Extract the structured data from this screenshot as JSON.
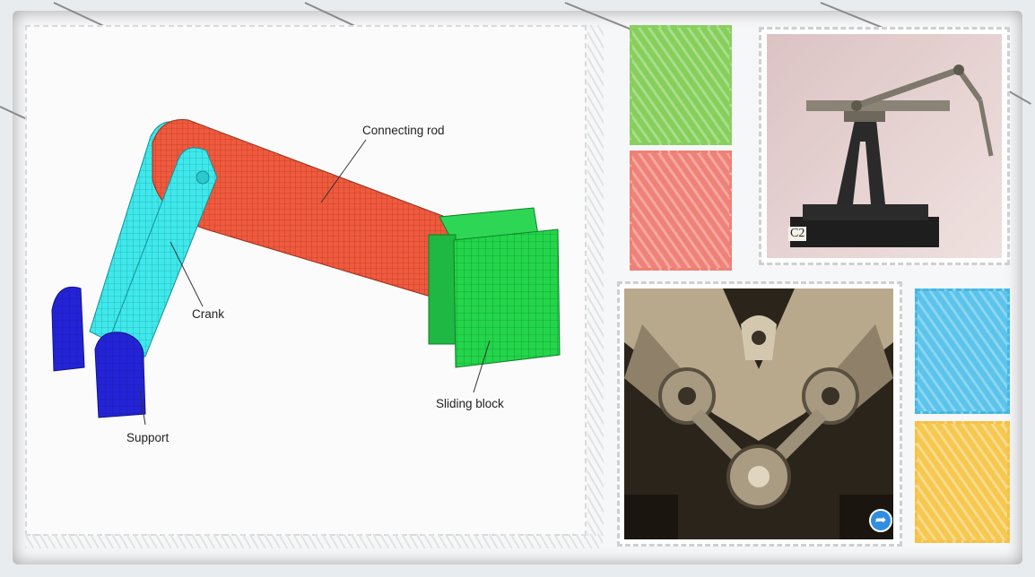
{
  "figure": {
    "labels": {
      "connecting_rod": "Connecting rod",
      "crank": "Crank",
      "sliding_block": "Sliding block",
      "support": "Support"
    },
    "mesh_colors": {
      "connecting_rod": "#ef5a3e",
      "crank": "#3fe8ea",
      "sliding_block": "#23d54a",
      "support": "#2424d6"
    }
  },
  "model_photo": {
    "tag": "C2"
  },
  "engine_photo": {
    "share_icon": "redo-arrow-icon"
  },
  "tile_colors": {
    "green": "#86cf5b",
    "red": "#ef8278",
    "blue": "#5cc4ea",
    "yellow": "#f6c84f"
  }
}
